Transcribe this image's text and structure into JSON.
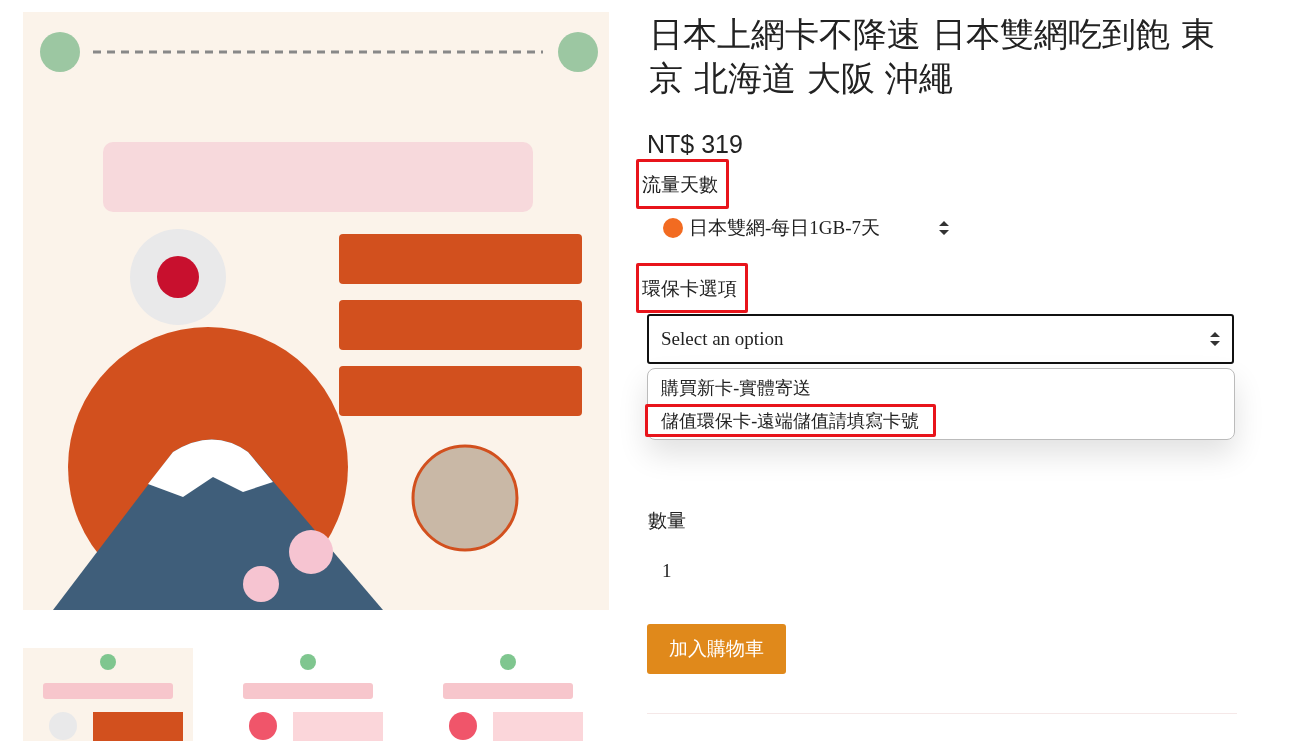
{
  "title": "日本上網卡不降速 日本雙網吃到飽 東京 北海道 大阪 沖繩",
  "price": "NT$ 319",
  "plan": {
    "label": "流量天數",
    "highlighted": true,
    "value": "日本雙網-每日1GB-7天",
    "color": "#f26b21"
  },
  "card_option": {
    "label": "環保卡選項",
    "highlighted": true,
    "placeholder": "Select an option",
    "expanded": true,
    "options": [
      {
        "label": "購買新卡-實體寄送",
        "highlighted": false
      },
      {
        "label": "儲值環保卡-遠端儲值請填寫卡號",
        "highlighted": true
      }
    ]
  },
  "quantity": {
    "label": "數量",
    "value": "1"
  },
  "add_to_cart": "加入購物車"
}
